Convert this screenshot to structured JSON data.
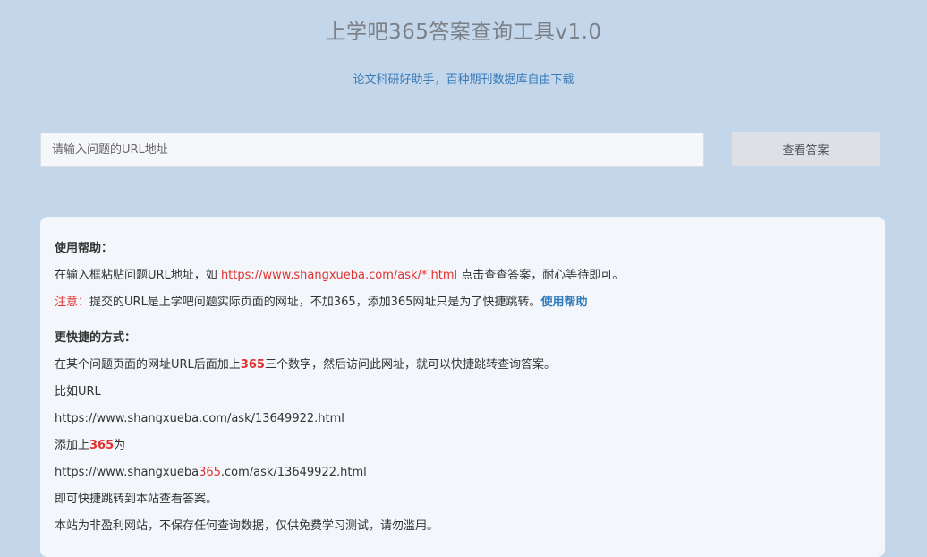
{
  "header": {
    "title": "上学吧365答案查询工具v1.0",
    "subtitle": "论文科研好助手，百种期刊数据库自由下载"
  },
  "search": {
    "placeholder": "请输入问题的URL地址",
    "value": "",
    "button_label": "查看答案"
  },
  "help": {
    "section1_title": "使用帮助：",
    "line1_prefix": "在输入框粘贴问题URL地址，如 ",
    "line1_url": "https://www.shangxueba.com/ask/*.html",
    "line1_suffix": " 点击查查答案，耐心等待即可。",
    "note_label": "注意：",
    "note_text": "提交的URL是上学吧问题实际页面的网址，不加365，添加365网址只是为了快捷跳转。",
    "note_link": "使用帮助",
    "section2_title": "更快捷的方式：",
    "line2_prefix": "在某个问题页面的网址URL后面加上",
    "line2_highlight": "365",
    "line2_suffix": "三个数字，然后访问此网址，就可以快捷跳转查询答案。",
    "example_label": "比如URL",
    "example_url": "https://www.shangxueba.com/ask/13649922.html",
    "add_prefix": "添加上",
    "add_highlight": "365",
    "add_suffix": "为",
    "result_url_part1": "https://www.shangxueba",
    "result_url_highlight": "365",
    "result_url_part2": ".com/ask/13649922.html",
    "jump_text": "即可快捷跳转到本站查看答案。",
    "disclaimer": "本站为非盈利网站，不保存任何查询数据，仅供免费学习测试，请勿滥用。"
  },
  "colors": {
    "background": "#c3d6ea",
    "accent_blue": "#3a7bb8",
    "highlight_red": "#e03131"
  }
}
